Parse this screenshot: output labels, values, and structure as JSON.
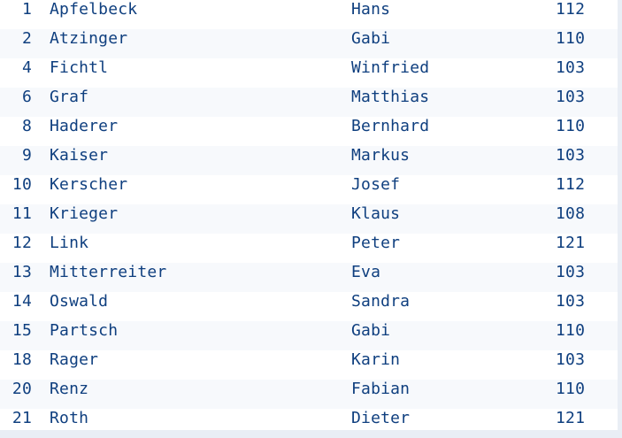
{
  "table": {
    "rows": [
      {
        "id": "1",
        "last_name": "Apfelbeck",
        "first_name": "Hans",
        "number": "112"
      },
      {
        "id": "2",
        "last_name": "Atzinger",
        "first_name": "Gabi",
        "number": "110"
      },
      {
        "id": "4",
        "last_name": "Fichtl",
        "first_name": "Winfried",
        "number": "103"
      },
      {
        "id": "6",
        "last_name": "Graf",
        "first_name": "Matthias",
        "number": "103"
      },
      {
        "id": "8",
        "last_name": "Haderer",
        "first_name": "Bernhard",
        "number": "110"
      },
      {
        "id": "9",
        "last_name": "Kaiser",
        "first_name": "Markus",
        "number": "103"
      },
      {
        "id": "10",
        "last_name": "Kerscher",
        "first_name": "Josef",
        "number": "112"
      },
      {
        "id": "11",
        "last_name": "Krieger",
        "first_name": "Klaus",
        "number": "108"
      },
      {
        "id": "12",
        "last_name": "Link",
        "first_name": "Peter",
        "number": "121"
      },
      {
        "id": "13",
        "last_name": "Mitterreiter",
        "first_name": "Eva",
        "number": "103"
      },
      {
        "id": "14",
        "last_name": "Oswald",
        "first_name": "Sandra",
        "number": "103"
      },
      {
        "id": "15",
        "last_name": "Partsch",
        "first_name": "Gabi",
        "number": "110"
      },
      {
        "id": "18",
        "last_name": "Rager",
        "first_name": "Karin",
        "number": "103"
      },
      {
        "id": "20",
        "last_name": "Renz",
        "first_name": "Fabian",
        "number": "110"
      },
      {
        "id": "21",
        "last_name": "Roth",
        "first_name": "Dieter",
        "number": "121"
      }
    ]
  },
  "colors": {
    "text": "#0f3f7f",
    "background": "#ffffff",
    "frame": "#e9eef5"
  }
}
